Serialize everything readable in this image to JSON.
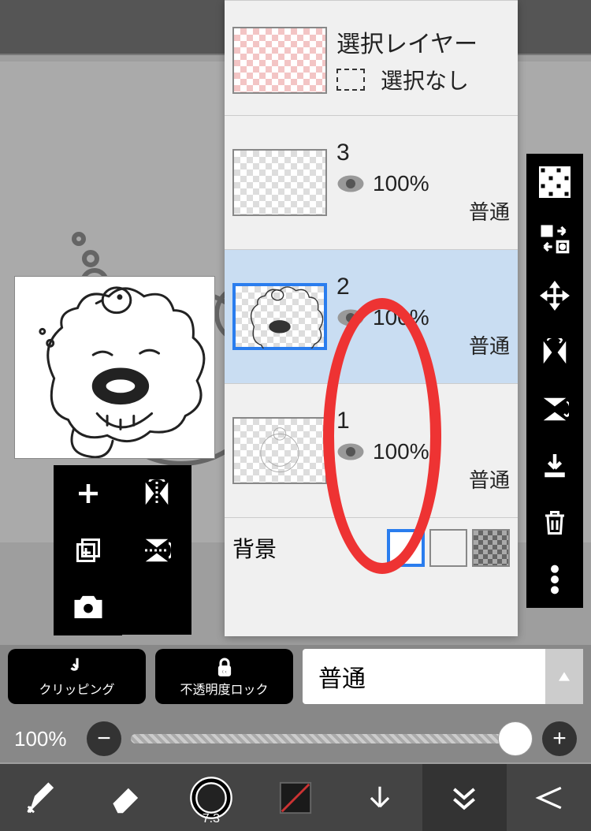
{
  "selection_layer": {
    "title": "選択レイヤー",
    "state": "選択なし"
  },
  "layers": [
    {
      "name": "3",
      "opacity": "100%",
      "blend": "普通"
    },
    {
      "name": "2",
      "opacity": "100%",
      "blend": "普通"
    },
    {
      "name": "1",
      "opacity": "100%",
      "blend": "普通"
    }
  ],
  "background": {
    "label": "背景"
  },
  "bottom": {
    "clipping": "クリッピング",
    "alpha_lock": "不透明度ロック",
    "blend_mode": "普通",
    "opacity": "100%"
  },
  "brush": {
    "size": "7.3"
  }
}
